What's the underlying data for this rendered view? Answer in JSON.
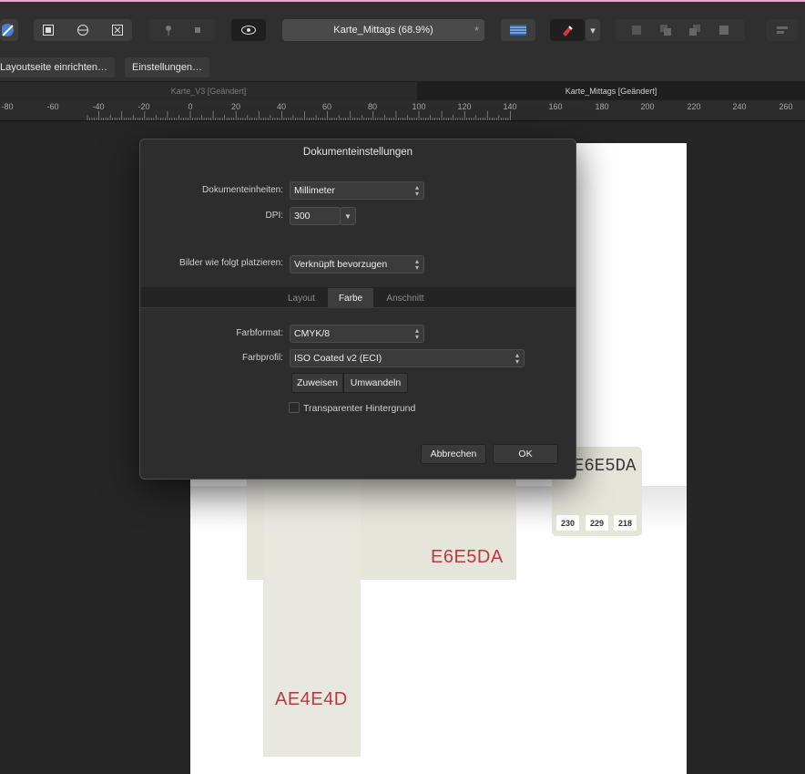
{
  "toolbar": {
    "document_name": "Karte_Mittags (68.9%)",
    "modified_marker": "*"
  },
  "context_bar": {
    "layout_button": "Layoutseite einrichten…",
    "settings_button": "Einstellungen…"
  },
  "document_tabs": [
    {
      "label": "Karte_V3 [Geändert]",
      "active": false
    },
    {
      "label": "Karte_Mittags [Geändert]",
      "active": true
    }
  ],
  "ruler": {
    "labels": [
      "-80",
      "-60",
      "-40",
      "-20",
      "0",
      "20",
      "40",
      "60",
      "80",
      "100",
      "120",
      "140",
      "160",
      "180",
      "200",
      "220",
      "240",
      "260"
    ]
  },
  "canvas": {
    "swatch_card_hex": "E6E5DA",
    "rgb_values": [
      "230",
      "229",
      "218"
    ],
    "label_e6e5da": "E6E5DA",
    "label_ae4e4d": "AE4E4D",
    "colors": {
      "swatch": "#E6E5DA",
      "label": "#B83A44"
    }
  },
  "dialog": {
    "title": "Dokumenteinstellungen",
    "units_label": "Dokumenteinheiten:",
    "units_value": "Millimeter",
    "dpi_label": "DPI:",
    "dpi_value": "300",
    "place_label": "Bilder wie folgt platzieren:",
    "place_value": "Verknüpft bevorzugen",
    "tabs": [
      "Layout",
      "Farbe",
      "Anschnitt"
    ],
    "active_tab": "Farbe",
    "color_format_label": "Farbformat:",
    "color_format_value": "CMYK/8",
    "color_profile_label": "Farbprofil:",
    "color_profile_value": "ISO Coated v2 (ECI)",
    "assign_button": "Zuweisen",
    "convert_button": "Umwandeln",
    "transparent_label": "Transparenter Hintergrund",
    "transparent_checked": false,
    "cancel_button": "Abbrechen",
    "ok_button": "OK"
  }
}
